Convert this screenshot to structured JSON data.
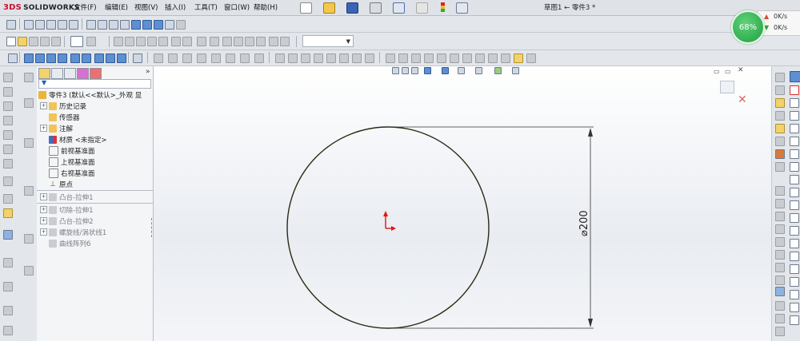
{
  "app": {
    "brand_prefix": "3DS",
    "brand": "SOLIDWORKS",
    "document_title": "草图1 ← 零件3 *"
  },
  "menu": [
    {
      "label": "文件(F)"
    },
    {
      "label": "编辑(E)"
    },
    {
      "label": "视图(V)"
    },
    {
      "label": "插入(I)"
    },
    {
      "label": "工具(T)"
    },
    {
      "label": "窗口(W)"
    },
    {
      "label": "帮助(H)"
    }
  ],
  "status_overlay": {
    "cpu_percent": "68%",
    "upload_speed": "0K/s",
    "download_speed": "0K/s",
    "colors": {
      "cpu": "#2cae4e",
      "up": "#d34a3a",
      "down": "#3a9a3a"
    }
  },
  "feature_tree": {
    "root": "零件3 (默认<<默认>_外观 显",
    "items": [
      {
        "label": "历史记录",
        "expandable": true,
        "dim": false,
        "icon": "history-icon"
      },
      {
        "label": "传感器",
        "expandable": false,
        "dim": false,
        "icon": "sensor-icon"
      },
      {
        "label": "注解",
        "expandable": true,
        "dim": false,
        "icon": "annotation-icon"
      },
      {
        "label": "材质 <未指定>",
        "expandable": false,
        "dim": false,
        "icon": "material-icon"
      },
      {
        "label": "前视基准面",
        "expandable": false,
        "dim": false,
        "icon": "plane-icon"
      },
      {
        "label": "上视基准面",
        "expandable": false,
        "dim": false,
        "icon": "plane-icon"
      },
      {
        "label": "右视基准面",
        "expandable": false,
        "dim": false,
        "icon": "plane-icon"
      },
      {
        "label": "原点",
        "expandable": false,
        "dim": false,
        "icon": "origin-icon"
      },
      {
        "label": "凸台-拉伸1",
        "expandable": true,
        "dim": true,
        "icon": "extrude-icon"
      },
      {
        "label": "切除-拉伸1",
        "expandable": true,
        "dim": true,
        "icon": "cut-extrude-icon"
      },
      {
        "label": "凸台-拉伸2",
        "expandable": true,
        "dim": true,
        "icon": "extrude-icon"
      },
      {
        "label": "螺旋线/涡状线1",
        "expandable": true,
        "dim": true,
        "icon": "helix-icon"
      },
      {
        "label": "曲线阵列6",
        "expandable": false,
        "dim": true,
        "icon": "curve-pattern-icon"
      }
    ]
  },
  "sketch": {
    "diameter_label": "⌀200",
    "colors": {
      "circle": "#2a2a12",
      "origin": "#e01515",
      "dimension": "#333333"
    }
  }
}
